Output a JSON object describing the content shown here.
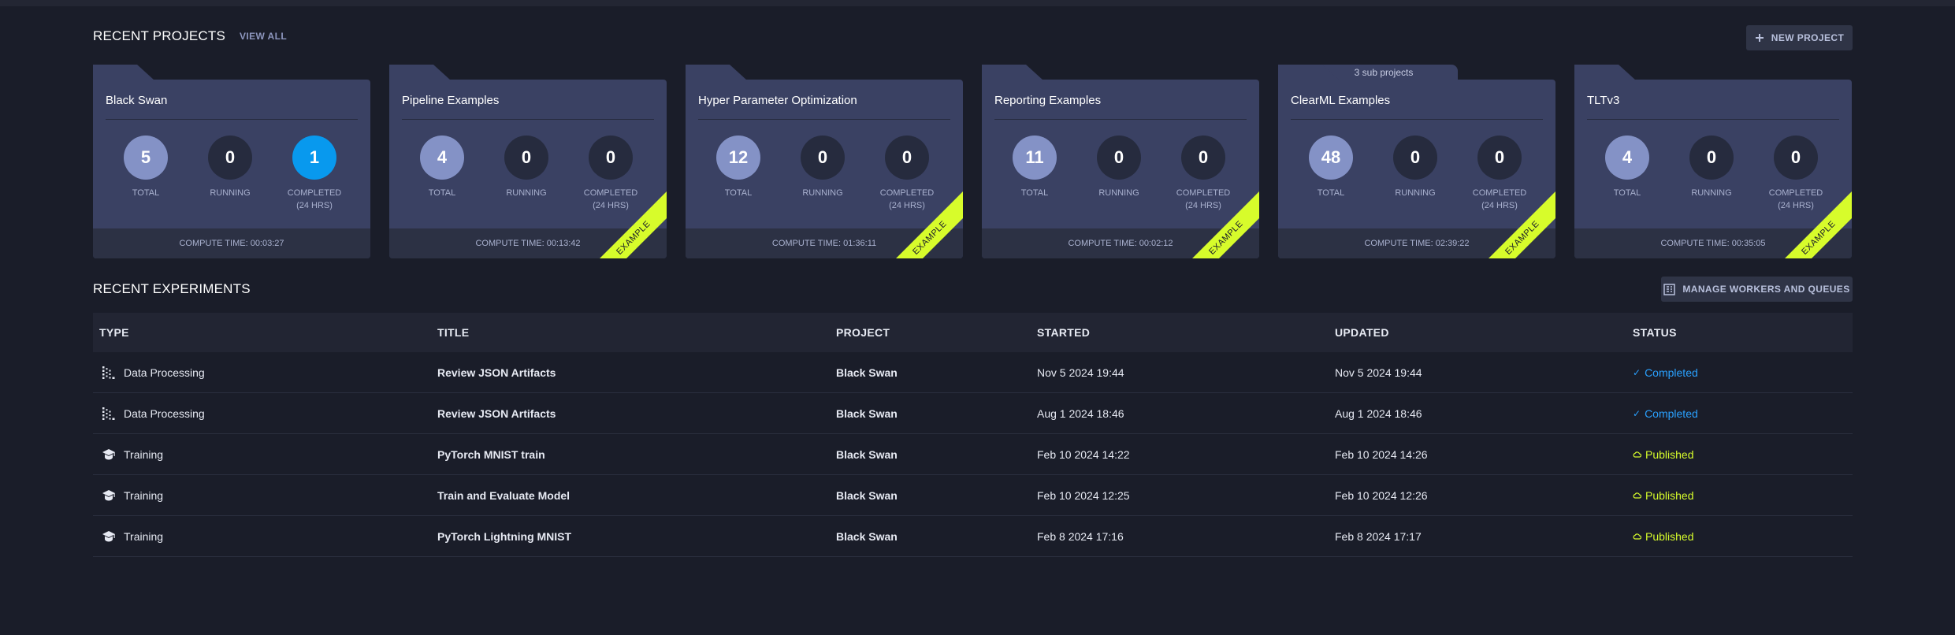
{
  "projects_section": {
    "title": "RECENT PROJECTS",
    "view_all": "VIEW ALL",
    "new_project": "NEW PROJECT"
  },
  "projects": [
    {
      "name": "Black Swan",
      "sub_projects": "",
      "total": "5",
      "running": "0",
      "completed": "1",
      "compute_time": "COMPUTE TIME: 00:03:27",
      "example": ""
    },
    {
      "name": "Pipeline Examples",
      "sub_projects": "",
      "total": "4",
      "running": "0",
      "completed": "0",
      "compute_time": "COMPUTE TIME: 00:13:42",
      "example": "EXAMPLE"
    },
    {
      "name": "Hyper Parameter Optimization",
      "sub_projects": "",
      "total": "12",
      "running": "0",
      "completed": "0",
      "compute_time": "COMPUTE TIME: 01:36:11",
      "example": "EXAMPLE"
    },
    {
      "name": "Reporting Examples",
      "sub_projects": "",
      "total": "11",
      "running": "0",
      "completed": "0",
      "compute_time": "COMPUTE TIME: 00:02:12",
      "example": "EXAMPLE"
    },
    {
      "name": "ClearML Examples",
      "sub_projects": "3 sub projects",
      "total": "48",
      "running": "0",
      "completed": "0",
      "compute_time": "COMPUTE TIME: 02:39:22",
      "example": "EXAMPLE"
    },
    {
      "name": "TLTv3",
      "sub_projects": "",
      "total": "4",
      "running": "0",
      "completed": "0",
      "compute_time": "COMPUTE TIME: 00:35:05",
      "example": "EXAMPLE"
    }
  ],
  "stat_labels": {
    "total": "TOTAL",
    "running": "RUNNING",
    "completed": "COMPLETED",
    "completed_sub": "(24 hrs)"
  },
  "experiments_section": {
    "title": "RECENT EXPERIMENTS",
    "manage_workers": "MANAGE WORKERS AND QUEUES"
  },
  "table": {
    "columns": [
      "TYPE",
      "TITLE",
      "PROJECT",
      "STARTED",
      "UPDATED",
      "STATUS"
    ],
    "rows": [
      {
        "type": "Data Processing",
        "type_icon": "data-processing-icon",
        "title": "Review JSON Artifacts",
        "project": "Black Swan",
        "started": "Nov 5 2024 19:44",
        "updated": "Nov 5 2024 19:44",
        "status": "Completed",
        "status_icon": "check-icon"
      },
      {
        "type": "Data Processing",
        "type_icon": "data-processing-icon",
        "title": "Review JSON Artifacts",
        "project": "Black Swan",
        "started": "Aug 1 2024 18:46",
        "updated": "Aug 1 2024 18:46",
        "status": "Completed",
        "status_icon": "check-icon"
      },
      {
        "type": "Training",
        "type_icon": "training-icon",
        "title": "PyTorch MNIST train",
        "project": "Black Swan",
        "started": "Feb 10 2024 14:22",
        "updated": "Feb 10 2024 14:26",
        "status": "Published",
        "status_icon": "cloud-icon"
      },
      {
        "type": "Training",
        "type_icon": "training-icon",
        "title": "Train and Evaluate Model",
        "project": "Black Swan",
        "started": "Feb 10 2024 12:25",
        "updated": "Feb 10 2024 12:26",
        "status": "Published",
        "status_icon": "cloud-icon"
      },
      {
        "type": "Training",
        "type_icon": "training-icon",
        "title": "PyTorch Lightning MNIST",
        "project": "Black Swan",
        "started": "Feb 8 2024 17:16",
        "updated": "Feb 8 2024 17:17",
        "status": "Published",
        "status_icon": "cloud-icon"
      }
    ]
  },
  "colors": {
    "background": "#1a1d29",
    "card": "#3a4163",
    "total_circle": "#8492c6",
    "completed_active": "#0899ee",
    "example_ribbon": "#d7fc2b",
    "status_completed": "#2aa1ff",
    "status_published": "#d7fc2b"
  }
}
